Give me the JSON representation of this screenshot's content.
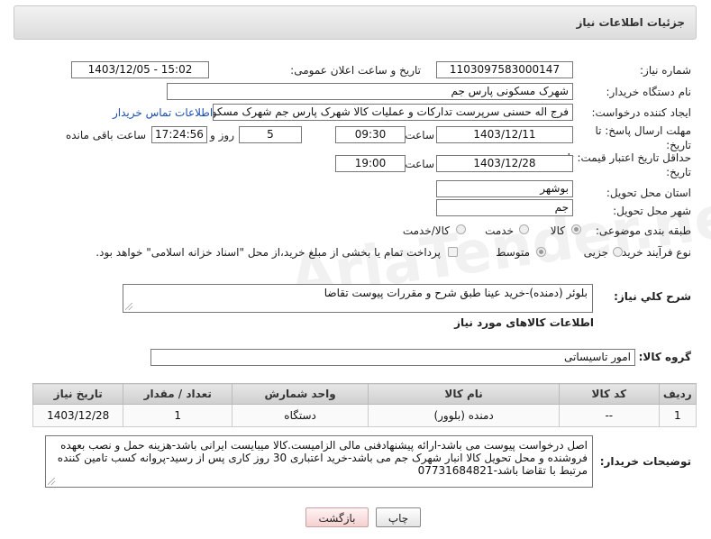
{
  "header": {
    "title": "جزئیات اطلاعات نیاز"
  },
  "labels": {
    "need_number": "شماره نیاز:",
    "announce_datetime": "تاریخ و ساعت اعلان عمومی:",
    "buyer_org": "نام دستگاه خریدار:",
    "requester": "ایجاد کننده درخواست:",
    "reply_deadline": "مهلت ارسال پاسخ: تا تاریخ:",
    "hour": "ساعت",
    "day_and": "روز و",
    "remaining": "ساعت باقی مانده",
    "min_validity": "حداقل تاریخ اعتبار قیمت: تا تاریخ:",
    "hour2": "ساعت",
    "province": "استان محل تحویل:",
    "city": "شهر محل تحویل:",
    "category": "طبقه بندی موضوعی:",
    "process_type": "نوع فرآیند خرید :",
    "description": "شرح کلي نياز:",
    "goods_info": "اطلاعات کالاهای مورد نیاز",
    "goods_group": "گروه کالا:",
    "buyer_notes": "توضیحات خریدار:"
  },
  "values": {
    "need_number": "1103097583000147",
    "announce_datetime": "1403/12/05 - 15:02",
    "buyer_org": "شهرک مسکونی پارس جم",
    "requester": "فرج اله حسنی سرپرست تدارکات و عملیات کالا شهرک پارس جم شهرک مسکو",
    "contact_link": "اطلاعات تماس خریدار",
    "reply_date": "1403/12/11",
    "reply_time": "09:30",
    "days": "5",
    "remaining_time": "17:24:56",
    "validity_date": "1403/12/28",
    "validity_time": "19:00",
    "province": "بوشهر",
    "city": "جم",
    "description": "بلوئر (دمنده)-خرید عینا طبق شرح و مقررات پیوست تقاضا",
    "goods_group": "امور تاسیساتی",
    "buyer_notes": "اصل درخواست پیوست می باشد-ارائه پیشنهادفنی مالی الزامیست.کالا میبایست ایرانی باشد-هزینه حمل و نصب بعهده فروشنده و محل تحویل کالا انبار شهرک جم می باشد-خرید اعتباری  30 روز کاری پس از رسید-پروانه کسب تامین کننده مرتبط با تقاضا باشد-07731684821"
  },
  "options": {
    "category": [
      "کالا",
      "خدمت",
      "کالا/خدمت"
    ],
    "category_selected": "کالا",
    "process": [
      "جزیی",
      "متوسط"
    ],
    "process_selected": "متوسط",
    "payment_note": "پرداخت تمام یا بخشی از مبلغ خرید،از محل \"اسناد خزانه اسلامی\" خواهد بود."
  },
  "table": {
    "headers": [
      "ردیف",
      "کد کالا",
      "نام کالا",
      "واحد شمارش",
      "تعداد / مقدار",
      "تاریخ نیاز"
    ],
    "rows": [
      [
        "1",
        "--",
        "دمنده (بلوور)",
        "دستگاه",
        "1",
        "1403/12/28"
      ]
    ]
  },
  "buttons": {
    "print": "چاپ",
    "back": "بازگشت"
  },
  "watermark": "AriaTender.neT"
}
